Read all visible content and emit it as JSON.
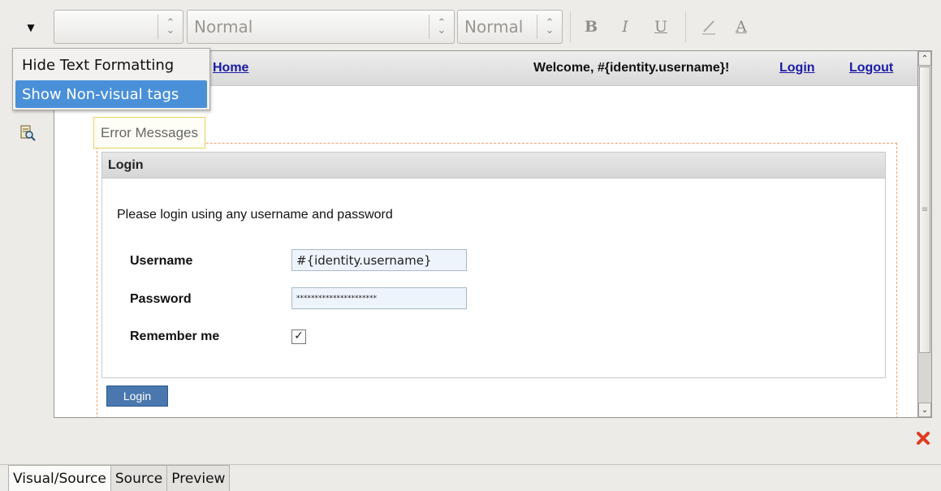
{
  "toolbar": {
    "font_family_value": "",
    "paragraph_style": "Normal",
    "font_size": "Normal",
    "bold_label": "B",
    "italic_label": "I",
    "underline_label": "U",
    "font_color_icon": "highlighter-icon",
    "text_color_label": "A"
  },
  "menu": {
    "items": [
      {
        "label": "Hide Text Formatting"
      },
      {
        "label": "Show Non-visual tags"
      }
    ]
  },
  "page": {
    "header": {
      "home_link": "Home",
      "welcome": "Welcome, #{identity.username}!",
      "login_link": "Login",
      "logout_link": "Logout"
    },
    "error_messages_label": "Error Messages",
    "panel_title": "Login",
    "intro": "Please login using any username and password",
    "fields": [
      {
        "label": "Username",
        "value": "#{identity.username}"
      },
      {
        "label": "Password",
        "value": "**********************"
      },
      {
        "label": "Remember me",
        "checked": "✓"
      }
    ],
    "login_button": "Login"
  },
  "tabs": [
    {
      "label": "Visual/Source"
    },
    {
      "label": "Source"
    },
    {
      "label": "Preview"
    }
  ],
  "colors": {
    "link": "#1a1aa6",
    "menu_selection": "#4a90d9",
    "button": "#4a77ad",
    "close": "#e03a20"
  }
}
